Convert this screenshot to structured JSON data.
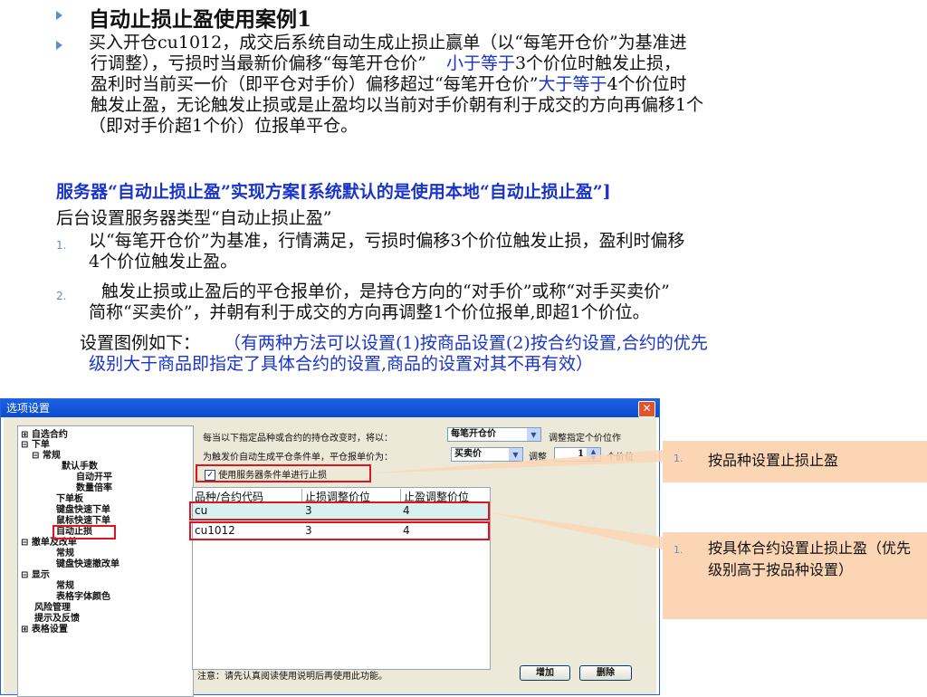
{
  "slide": {
    "heading": "自动止损止盈使用案例1",
    "para1_lines": [
      "买入开仓cu1012，成交后系统自动生成止损止赢单（以“每笔开仓价”为基准进",
      "行调整），亏损时当最新价偏移“每笔开仓价”",
      "盈利时当前买一价（即平仓对手价）偏移超过“每笔开仓价”",
      "触发止盈，无论触发止损或是止盈均以当前对手价朝有利于成交的方向再偏移1个",
      "（即对手价超1个价）位报单平仓。"
    ],
    "para1_blue1": "小于等于",
    "para1_after1": "3个价位时触发止损，",
    "para1_blue2": "大于等于",
    "para1_after2": "4个价位时",
    "server_heading": "服务器“自动止损止盈”实现方案[系统默认的是使用本地“自动止损止盈”]",
    "server_sub": "后台设置服务器类型“自动止损止盈”",
    "item1_num": "1.",
    "item1_lines": [
      "以“每笔开仓价”为基准，行情满足，亏损时偏移3个价位触发止损，盈利时偏移",
      "4个价位触发止盈。"
    ],
    "item2_num": "2.",
    "item2_lines": [
      "触发止损或止盈后的平仓报单价，是持仓方向的“对手价”或称“对手买卖价”",
      "简称“买卖价”，并朝有利于成交的方向再调整1个价位报单,即超1个价位。"
    ],
    "setting_prefix": "设置图例如下：",
    "setting_blue_lines": [
      "（有两种方法可以设置(1)按商品设置(2)按合约设置,合约的优先",
      "级别大于商品即指定了具体合约的设置,商品的设置对其不再有效）"
    ]
  },
  "dialog": {
    "title": "选项设置",
    "close_glyph": "✕",
    "tree": [
      {
        "label": "自选合约",
        "toggle": "⊞"
      },
      {
        "label": "下单",
        "toggle": "⊟"
      },
      {
        "label": "常规",
        "toggle": "⊟"
      },
      {
        "label": "默认手数"
      },
      {
        "label": "自动开平"
      },
      {
        "label": "数量倍率"
      },
      {
        "label": "下单板"
      },
      {
        "label": "键盘快速下单"
      },
      {
        "label": "鼠标快速下单"
      },
      {
        "label": "自动止损"
      },
      {
        "label": "撤单及改单",
        "toggle": "⊟"
      },
      {
        "label": "常规"
      },
      {
        "label": "键盘快速撤改单"
      },
      {
        "label": "显示",
        "toggle": "⊟"
      },
      {
        "label": "常规"
      },
      {
        "label": "表格字体颜色"
      },
      {
        "label": "风险管理"
      },
      {
        "label": "提示及反馈"
      },
      {
        "label": "表格设置",
        "toggle": "⊞"
      }
    ],
    "row1_label": "每当以下指定品种或合约的持仓改变时，将以：",
    "row1_select": "每笔开仓价",
    "row1_tail": "调整指定个价位作",
    "row2_label": "为触发价自动生成平仓条件单，平仓报单价为：",
    "row2_select": "买卖价",
    "row2_adjust": "调整",
    "row2_value": "1",
    "row2_tail": "个价位",
    "checkbox_label": "使用服务器条件单进行止损",
    "checkbox_checked": true,
    "grid_headers": [
      "品种/合约代码",
      "止损调整价位",
      "止盈调整价位"
    ],
    "grid_rows": [
      [
        "cu",
        "3",
        "4"
      ],
      [
        "cu1012",
        "3",
        "4"
      ]
    ],
    "note": "注意：请先认真阅读使用说明后再使用此功能。",
    "add_button": "增加",
    "delete_button": "删除"
  },
  "callouts": [
    {
      "num": "1.",
      "text": "按品种设置止损止盈"
    },
    {
      "num": "1.",
      "text": "按具体合约设置止损止盈（优先级别高于按品种设置）"
    }
  ],
  "colors": {
    "blue_text": "#1a34c9",
    "red_box": "#e0141e",
    "callout_fill": "#fcd6b4",
    "bullet": "#5b8fc7"
  }
}
